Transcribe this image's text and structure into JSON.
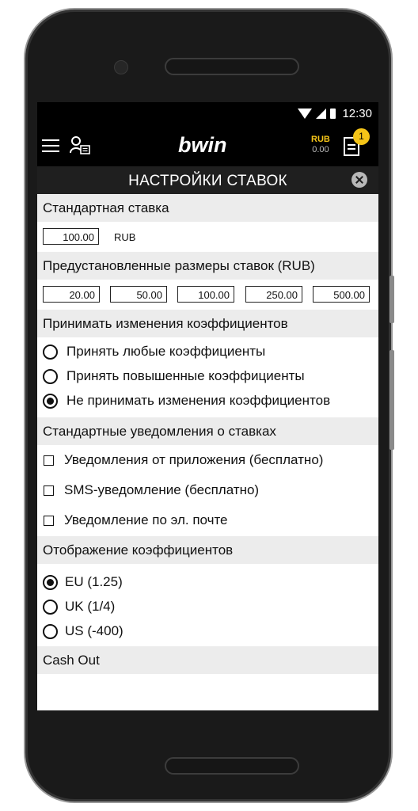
{
  "statusbar": {
    "time": "12:30"
  },
  "appbar": {
    "logo": "bwin",
    "balance_currency": "RUB",
    "balance_amount": "0.00",
    "betslip_count": "1"
  },
  "header": {
    "title": "НАСТРОЙКИ СТАВОК"
  },
  "default_stake": {
    "section_title": "Стандартная ставка",
    "value": "100.00",
    "currency": "RUB"
  },
  "preset_stakes": {
    "section_title": "Предустановленные размеры ставок (RUB)",
    "values": [
      "20.00",
      "50.00",
      "100.00",
      "250.00",
      "500.00"
    ]
  },
  "odds_changes": {
    "section_title": "Принимать изменения коэффициентов",
    "options": [
      {
        "label": "Принять любые коэффициенты",
        "selected": false
      },
      {
        "label": "Принять повышенные коэффициенты",
        "selected": false
      },
      {
        "label": "Не принимать изменения коэффициентов",
        "selected": true
      }
    ]
  },
  "notifications": {
    "section_title": "Стандартные уведомления о ставках",
    "options": [
      {
        "label": "Уведомления от приложения (бесплатно)",
        "checked": false
      },
      {
        "label": "SMS-уведомление (бесплатно)",
        "checked": false
      },
      {
        "label": "Уведомление по эл. почте",
        "checked": false
      }
    ]
  },
  "odds_format": {
    "section_title": "Отображение коэффициентов",
    "options": [
      {
        "label": "EU (1.25)",
        "selected": true
      },
      {
        "label": "UK (1/4)",
        "selected": false
      },
      {
        "label": "US (-400)",
        "selected": false
      }
    ]
  },
  "cash_out": {
    "section_title": "Cash Out"
  },
  "colors": {
    "accent": "#f5c518",
    "appbar": "#000000",
    "section_bg": "#ececec"
  }
}
